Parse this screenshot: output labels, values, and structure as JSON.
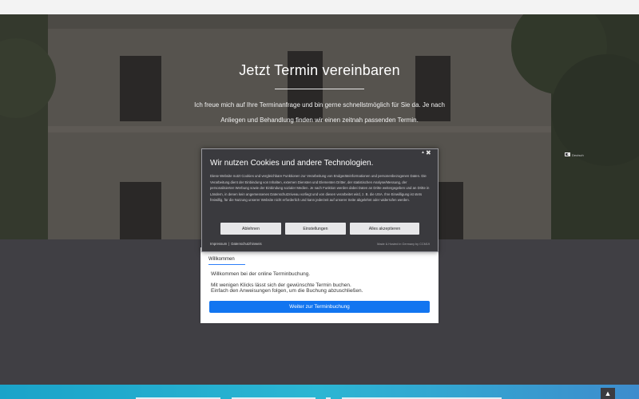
{
  "hero": {
    "title": "Jetzt Termin vereinbaren",
    "text": "Ich freue mich auf Ihre Terminanfrage und bin gerne schnellstmöglich für Sie da. Je nach Anliegen und Behandlung finden wir einen zeitnah passenden Termin."
  },
  "booking": {
    "tab": "Willkommen",
    "welcome": "Willkommen bei der online Terminbuchung.",
    "instructions_1": "Mit wenigen Klicks lässt sich der gewünschte Termin buchen.",
    "instructions_2": "Einfach den Anweisungen folgen, um die Buchung abzuschließen.",
    "button": "Weiter zur Terminbuchung"
  },
  "cookie": {
    "language": "Deutsch",
    "title": "Wir nutzen Cookies und andere Technologien.",
    "body": "Diese Website nutzt Cookies und vergleichbare Funktionen zur Verarbeitung von Endgeräteinformationen und personenbezogenen Daten. Die Verarbeitung dient der Einbindung von Inhalten, externen Diensten und Elementen Dritter, der statistischen Analyse/Messung, der personalisierten Werbung sowie der Einbindung sozialer Medien. Je nach Funktion werden dabei Daten an Dritte weitergegeben und an Dritte in Ländern, in denen kein angemessenes Datenschutzniveau vorliegt und von diesen verarbeitet wird, z. B. die USA. Ihre Einwilligung ist stets freiwillig, für die Nutzung unserer Website nicht erforderlich und kann jederzeit auf unserer Seite abgelehnt oder widerrufen werden.",
    "buttons": {
      "reject": "Ablehnen",
      "settings": "Einstellungen",
      "accept": "Alles akzeptieren"
    },
    "link_imprint": "Impressum",
    "link_separator": "|",
    "link_privacy": "Datenschutzhinweis",
    "made_by": "Made & Hosted in Germany by CCM19"
  },
  "colors": {
    "primary_button": "#1275f0",
    "cookie_bg": "#3a3a3e",
    "page_bg": "#403f44",
    "footer_gradient": "#1aa3c9"
  },
  "icons": {
    "language": "flag-icon",
    "language_toggle": "chevron-icon",
    "close": "close-icon",
    "scroll_top": "chevron-up-icon"
  }
}
